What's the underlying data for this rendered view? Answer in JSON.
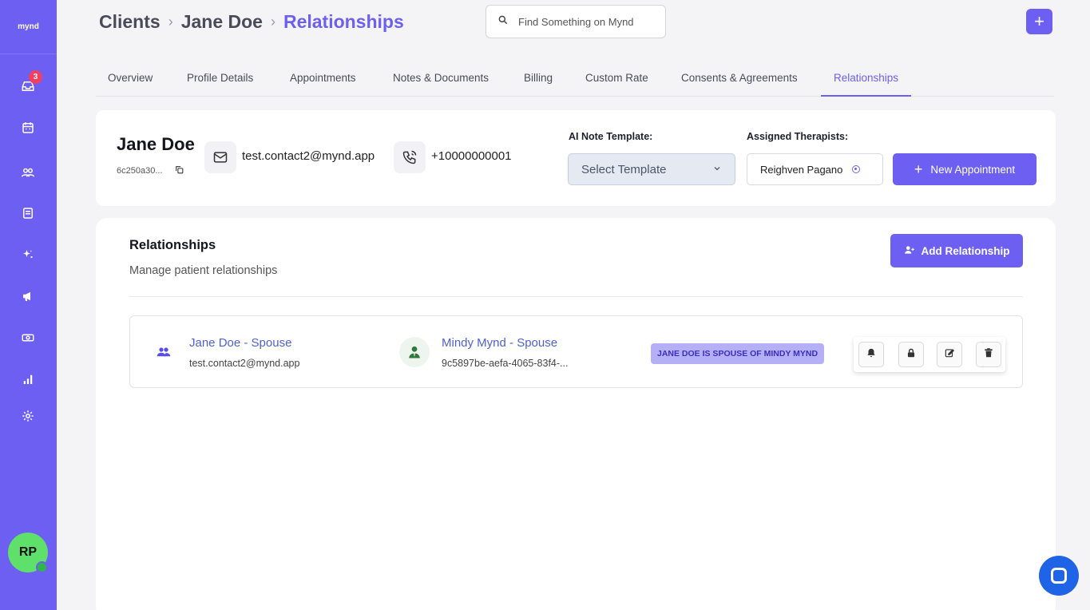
{
  "app": {
    "logo": "mynd"
  },
  "sidebar": {
    "inbox_badge": "3",
    "user_initials": "RP"
  },
  "header": {
    "breadcrumb": [
      "Clients",
      "Jane Doe",
      "Relationships"
    ],
    "search_placeholder": "Find Something on Mynd",
    "plus_label": "+"
  },
  "tabs": [
    "Overview",
    "Profile Details",
    "Appointments",
    "Notes & Documents",
    "Billing",
    "Custom Rate",
    "Consents & Agreements",
    "Relationships"
  ],
  "active_tab": "Relationships",
  "client": {
    "name": "Jane Doe",
    "id_short": "6c250a30...",
    "email": "test.contact2@mynd.app",
    "phone": "+10000000001",
    "note_template_label": "AI Note Template:",
    "note_template_value": "Select Template",
    "therapists_label": "Assigned Therapists:",
    "therapist": "Reighven Pagano",
    "new_appointment_label": "New Appointment"
  },
  "relationships": {
    "title": "Relationships",
    "subtitle": "Manage patient relationships",
    "add_label": "Add Relationship",
    "items": [
      {
        "from_name": "Jane Doe - Spouse",
        "from_email": "test.contact2@mynd.app",
        "to_name": "Mindy Mynd - Spouse",
        "to_id": "9c5897be-aefa-4065-83f4-...",
        "tag": "JANE DOE IS SPOUSE OF MINDY MYND"
      }
    ]
  },
  "colors": {
    "brand": "#6c5ff2",
    "link": "#4f62c8",
    "tag_bg": "#b5b0f5",
    "avatar": "#5ee06a",
    "chat": "#1f63e6"
  }
}
